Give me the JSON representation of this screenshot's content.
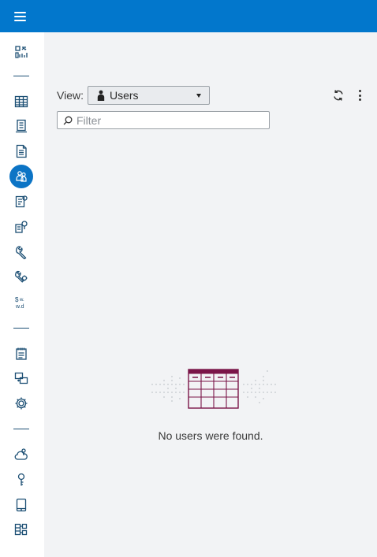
{
  "topbar": {
    "menu_icon": "hamburger-menu-icon",
    "bg_color": "#0277cc"
  },
  "sidebar": {
    "active_color": "#0c74c5",
    "items": [
      {
        "id": "dashboard",
        "icon": "dashboard-icon"
      },
      {
        "id": "data",
        "icon": "table-grid-icon"
      },
      {
        "id": "content",
        "icon": "server-icon"
      },
      {
        "id": "reports",
        "icon": "document-icon"
      },
      {
        "id": "users",
        "icon": "users-group-icon",
        "active": true
      },
      {
        "id": "jobs",
        "icon": "job-list-icon"
      },
      {
        "id": "credentials",
        "icon": "server-key-icon"
      },
      {
        "id": "configuration",
        "icon": "wrench-icon"
      },
      {
        "id": "configuration-settings",
        "icon": "wrench-gear-icon"
      },
      {
        "id": "formats",
        "icon": "currency-format-icon"
      },
      {
        "id": "logs",
        "icon": "notepad-icon"
      },
      {
        "id": "migration",
        "icon": "transfer-icon"
      },
      {
        "id": "settings",
        "icon": "gear-icon"
      },
      {
        "id": "cloud",
        "icon": "cloud-icon"
      },
      {
        "id": "keys",
        "icon": "key-icon"
      },
      {
        "id": "devices",
        "icon": "tablet-icon"
      },
      {
        "id": "workflows",
        "icon": "workflow-icon"
      }
    ]
  },
  "toolbar": {
    "view_label": "View:",
    "view_value": "Users",
    "refresh_icon": "refresh-icon",
    "more_icon": "more-vertical-icon"
  },
  "filter": {
    "placeholder": "Filter",
    "value": ""
  },
  "empty_state": {
    "icon": "empty-table-icon",
    "message": "No users were found.",
    "color": "#7a1548"
  }
}
